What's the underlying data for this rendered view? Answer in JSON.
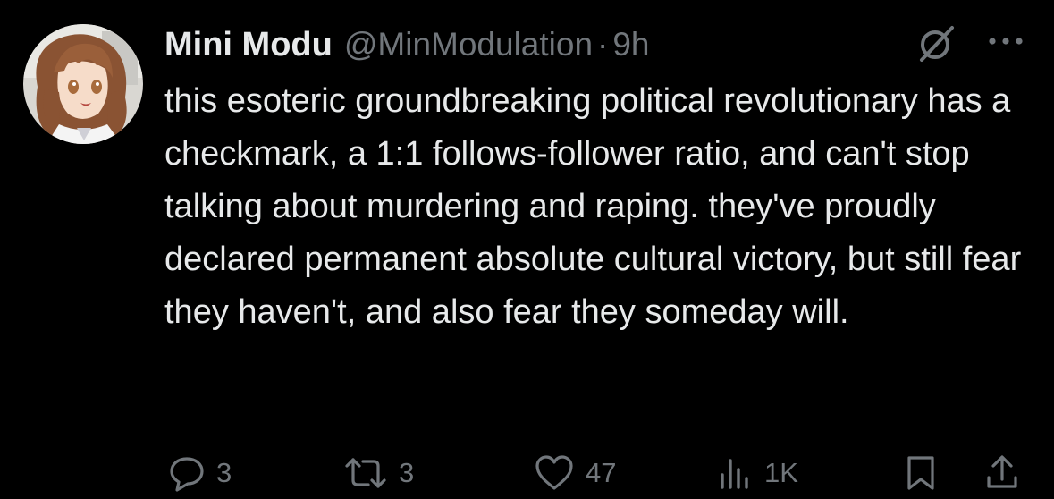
{
  "tweet": {
    "author": {
      "display_name": "Mini Modu",
      "handle": "@MinModulation",
      "separator": "·",
      "time": "9h"
    },
    "text": "this esoteric groundbreaking political revolutionary has a checkmark, a 1:1 follows-follower ratio, and can't stop talking about murdering and raping. they've proudly declared permanent absolute cultural victory, but still fear they haven't, and also fear they someday will."
  },
  "actions": {
    "replies": "3",
    "reposts": "3",
    "likes": "47",
    "views": "1K"
  },
  "icons": {
    "header": [
      "grok-icon",
      "more-icon"
    ],
    "actions": [
      "reply-icon",
      "repost-icon",
      "like-icon",
      "views-icon",
      "bookmark-icon",
      "share-icon"
    ]
  },
  "colors": {
    "background": "#000000",
    "text_primary": "#e7e9ea",
    "text_secondary": "#71767b"
  }
}
